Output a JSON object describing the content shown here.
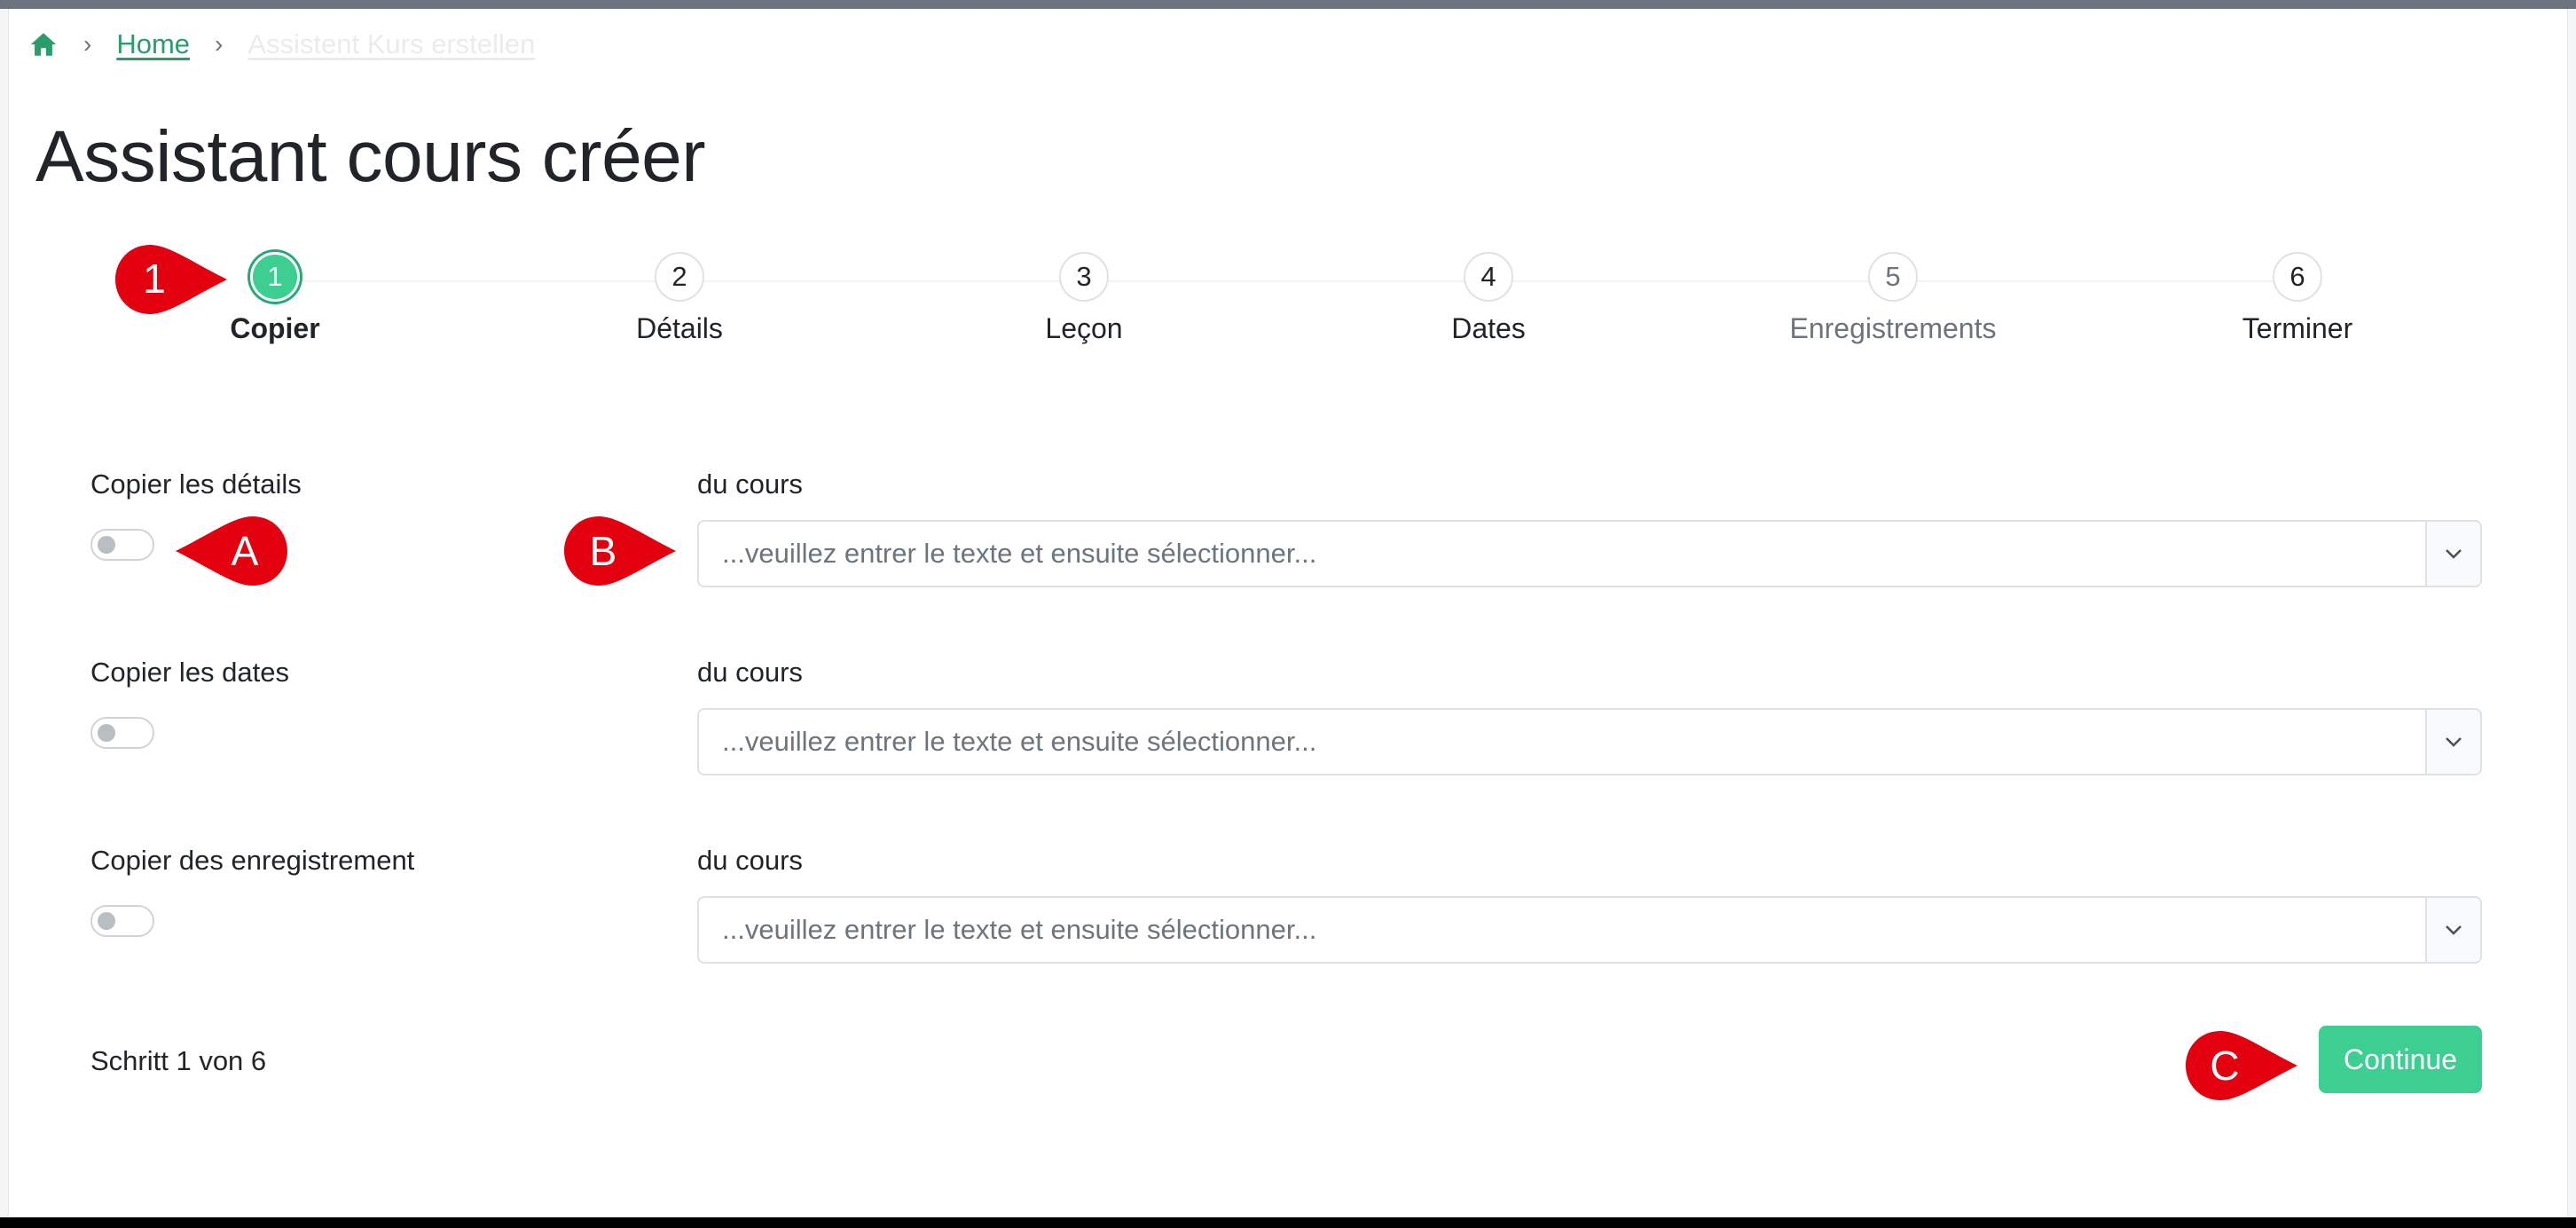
{
  "breadcrumb": {
    "home_icon": "home-icon",
    "separator": "›",
    "home_label": "Home",
    "current_label": "Assistent Kurs erstellen"
  },
  "page": {
    "title": "Assistant cours créer"
  },
  "stepper": {
    "steps": [
      {
        "number": "1",
        "label": "Copier",
        "state": "active"
      },
      {
        "number": "2",
        "label": "Détails",
        "state": "default"
      },
      {
        "number": "3",
        "label": "Leçon",
        "state": "default"
      },
      {
        "number": "4",
        "label": "Dates",
        "state": "default"
      },
      {
        "number": "5",
        "label": "Enregistrements",
        "state": "muted"
      },
      {
        "number": "6",
        "label": "Terminer",
        "state": "default"
      }
    ]
  },
  "form": {
    "rows": [
      {
        "toggle_label": "Copier les détails",
        "toggle_on": false,
        "select_label": "du cours",
        "select_placeholder": "...veuillez entrer le texte et ensuite sélectionner..."
      },
      {
        "toggle_label": "Copier les dates",
        "toggle_on": false,
        "select_label": "du cours",
        "select_placeholder": "...veuillez entrer le texte et ensuite sélectionner..."
      },
      {
        "toggle_label": "Copier des enregistrement",
        "toggle_on": false,
        "select_label": "du cours",
        "select_placeholder": "...veuillez entrer le texte et ensuite sélectionner..."
      }
    ]
  },
  "footer": {
    "step_text": "Schritt 1 von 6",
    "continue_label": "Continue"
  },
  "annotations": {
    "marker_step": "1",
    "marker_a": "A",
    "marker_b": "B",
    "marker_c": "C",
    "marker_color": "#e3000f"
  },
  "colors": {
    "accent": "#3ccf91",
    "link": "#2a9d6b",
    "topbar": "#6c757d"
  }
}
